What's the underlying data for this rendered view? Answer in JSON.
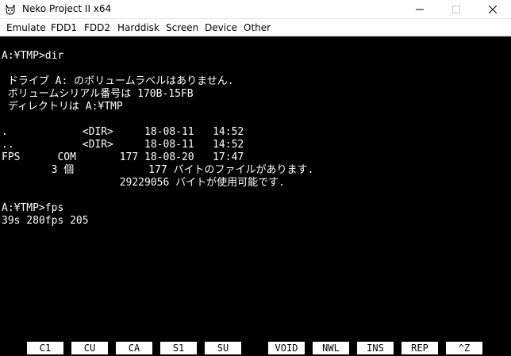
{
  "window": {
    "title": "Neko Project II x64"
  },
  "menu": {
    "items": [
      "Emulate",
      "FDD1",
      "FDD2",
      "Harddisk",
      "Screen",
      "Device",
      "Other"
    ]
  },
  "terminal": {
    "lines": [
      "A:¥TMP>dir",
      "",
      " ドライブ A: のボリュームラベルはありません.",
      " ボリュームシリアル番号は 170B-15FB",
      " ディレクトリは A:¥TMP",
      "",
      ".            <DIR>     18-08-11   14:52",
      "..           <DIR>     18-08-11   14:52",
      "FPS      COM       177 18-08-20   17:47",
      "        3 個            177 バイトのファイルがあります.",
      "                   29229056 バイトが使用可能です.",
      "",
      "A:¥TMP>fps",
      "39s 280fps 205"
    ]
  },
  "function_keys": [
    "C1",
    "CU",
    "CA",
    "S1",
    "SU",
    "VOID",
    "NWL",
    "INS",
    "REP",
    "^Z"
  ]
}
